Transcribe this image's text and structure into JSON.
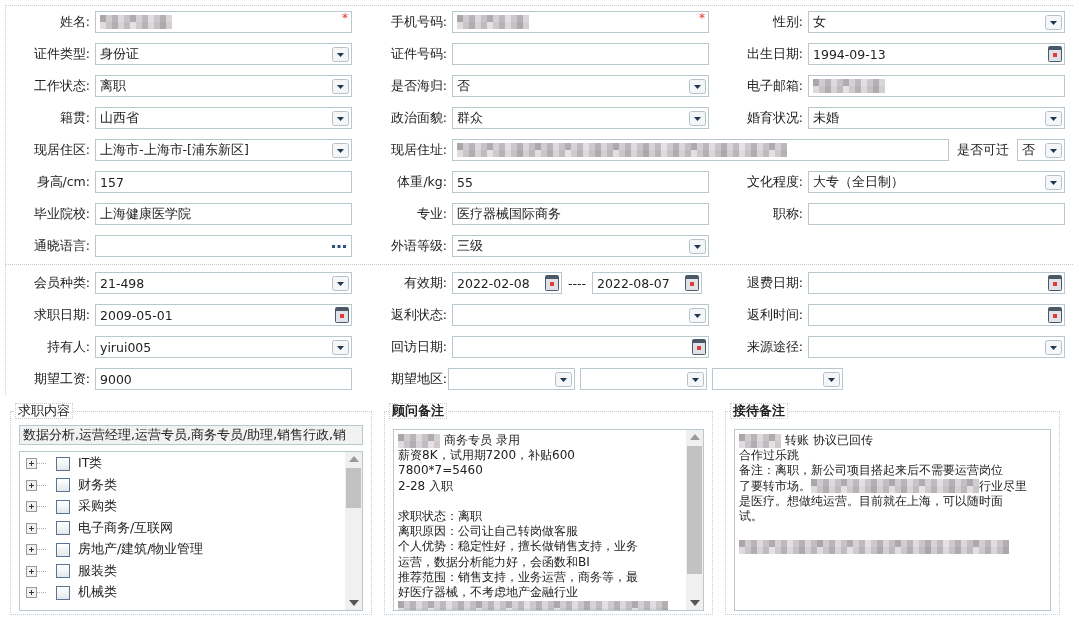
{
  "sections": [
    {
      "rows": [
        [
          {
            "label": "姓名:",
            "kind": "text",
            "blurred": true,
            "required_mark": "*"
          },
          {
            "label": "手机号码:",
            "kind": "text",
            "blurred": true,
            "required_mark": "*"
          },
          {
            "label": "性别:",
            "kind": "select",
            "value": "女"
          }
        ],
        [
          {
            "label": "证件类型:",
            "kind": "select",
            "value": "身份证"
          },
          {
            "label": "证件号码:",
            "kind": "text"
          },
          {
            "label": "出生日期:",
            "kind": "date",
            "value": "1994-09-13"
          }
        ],
        [
          {
            "label": "工作状态:",
            "kind": "select",
            "value": "离职"
          },
          {
            "label": "是否海归:",
            "kind": "select",
            "value": "否"
          },
          {
            "label": "电子邮箱:",
            "kind": "text",
            "blurred": true
          }
        ],
        [
          {
            "label": "籍贯:",
            "kind": "select",
            "value": "山西省"
          },
          {
            "label": "政治面貌:",
            "kind": "select",
            "value": "群众"
          },
          {
            "label": "婚育状况:",
            "kind": "select",
            "value": "未婚"
          }
        ],
        [
          {
            "label": "现居住区:",
            "kind": "select",
            "value": "上海市-上海市-[浦东新区]"
          },
          {
            "label": "现居住址:",
            "kind": "text",
            "blurred": true,
            "extra": {
              "label": "是否可迁",
              "kind": "select",
              "value": "否"
            }
          }
        ],
        [
          {
            "label": "身高/cm:",
            "kind": "text",
            "value": "157"
          },
          {
            "label": "体重/kg:",
            "kind": "text",
            "value": "55"
          },
          {
            "label": "文化程度:",
            "kind": "select",
            "value": "大专（全日制）"
          }
        ],
        [
          {
            "label": "毕业院校:",
            "kind": "text",
            "value": "上海健康医学院"
          },
          {
            "label": "专业:",
            "kind": "text",
            "value": "医疗器械国际商务"
          },
          {
            "label": "职称:",
            "kind": "text"
          }
        ],
        [
          {
            "label": "通晓语言:",
            "kind": "lookup"
          },
          {
            "label": "外语等级:",
            "kind": "select",
            "value": "三级"
          }
        ]
      ]
    },
    {
      "rows": [
        [
          {
            "label": "会员种类:",
            "kind": "select",
            "value": "21-498"
          },
          {
            "label": "有效期:",
            "kind": "date_range",
            "value": "2022-02-08",
            "separator": "----",
            "to_value": "2022-08-07"
          },
          {
            "label": "退费日期:",
            "kind": "date"
          }
        ],
        [
          {
            "label": "求职日期:",
            "kind": "date",
            "value": "2009-05-01"
          },
          {
            "label": "返利状态:",
            "kind": "select"
          },
          {
            "label": "返利时间:",
            "kind": "date"
          }
        ],
        [
          {
            "label": "持有人:",
            "kind": "select",
            "value": "yirui005"
          },
          {
            "label": "回访日期:",
            "kind": "date"
          },
          {
            "label": "来源途径:",
            "kind": "select"
          }
        ],
        [
          {
            "label": "期望工资:",
            "kind": "text",
            "value": "9000"
          },
          {
            "label": "期望地区:",
            "kind": "multi_select",
            "selects": [
              {
                "kind": "select"
              },
              {
                "kind": "select"
              },
              {
                "kind": "select"
              }
            ]
          }
        ]
      ]
    }
  ],
  "panels": [
    {
      "kind": "tree",
      "legend": "求职内容",
      "summary": "数据分析,运营经理,运营专员,商务专员/助理,销售行政,销",
      "items": [
        {
          "label": "IT类",
          "checked": false,
          "expanded": false
        },
        {
          "label": "财务类",
          "checked": false,
          "expanded": false
        },
        {
          "label": "采购类",
          "checked": false,
          "expanded": false
        },
        {
          "label": "电子商务/互联网",
          "checked": false,
          "expanded": false
        },
        {
          "label": "房地产/建筑/物业管理",
          "checked": false,
          "expanded": false
        },
        {
          "label": "服装类",
          "checked": false,
          "expanded": false
        },
        {
          "label": "机械类",
          "checked": false,
          "expanded": false
        }
      ]
    },
    {
      "kind": "notes",
      "legend": "顾问备注",
      "scrollbar": true,
      "lines": [
        [
          {
            "kind": "blur"
          },
          {
            "kind": "text",
            "text": " 商务专员 录用"
          }
        ],
        [
          {
            "kind": "text",
            "text": "薪资8K，试用期7200，补贴600"
          }
        ],
        [
          {
            "kind": "text",
            "text": "7800*7=5460"
          }
        ],
        [
          {
            "kind": "text",
            "text": "2-28 入职"
          }
        ],
        [
          {
            "kind": "gap"
          }
        ],
        [
          {
            "kind": "text",
            "text": "求职状态：离职"
          }
        ],
        [
          {
            "kind": "text",
            "text": "离职原因：公司让自己转岗做客服"
          }
        ],
        [
          {
            "kind": "text",
            "text": "个人优势：稳定性好，擅长做销售支持，业务"
          }
        ],
        [
          {
            "kind": "text",
            "text": "运营，数据分析能力好，会函数和BI"
          }
        ],
        [
          {
            "kind": "text",
            "text": "推荐范围：销售支持，业务运营，商务等，最"
          }
        ],
        [
          {
            "kind": "text",
            "text": "好医疗器械，不考虑地产金融行业"
          }
        ],
        [
          {
            "kind": "blur_line"
          }
        ]
      ]
    },
    {
      "kind": "notes",
      "legend": "接待备注",
      "scrollbar": false,
      "lines": [
        [
          {
            "kind": "blur"
          },
          {
            "kind": "text",
            "text": " 转账 协议已回传"
          }
        ],
        [
          {
            "kind": "text",
            "text": "合作过乐跳"
          }
        ],
        [
          {
            "kind": "text",
            "text": "备注：离职，新公司项目搭起来后不需要运营岗位"
          }
        ],
        [
          {
            "kind": "text",
            "text": "了要转市场。"
          },
          {
            "kind": "blur_wide"
          },
          {
            "kind": "text",
            "text": "行业尽里"
          }
        ],
        [
          {
            "kind": "text",
            "text": "是医疗。想做纯运营。目前就在上海，可以随时面"
          }
        ],
        [
          {
            "kind": "text",
            "text": "试。"
          }
        ],
        [
          {
            "kind": "gap"
          }
        ],
        [
          {
            "kind": "blur_line"
          }
        ]
      ]
    }
  ]
}
